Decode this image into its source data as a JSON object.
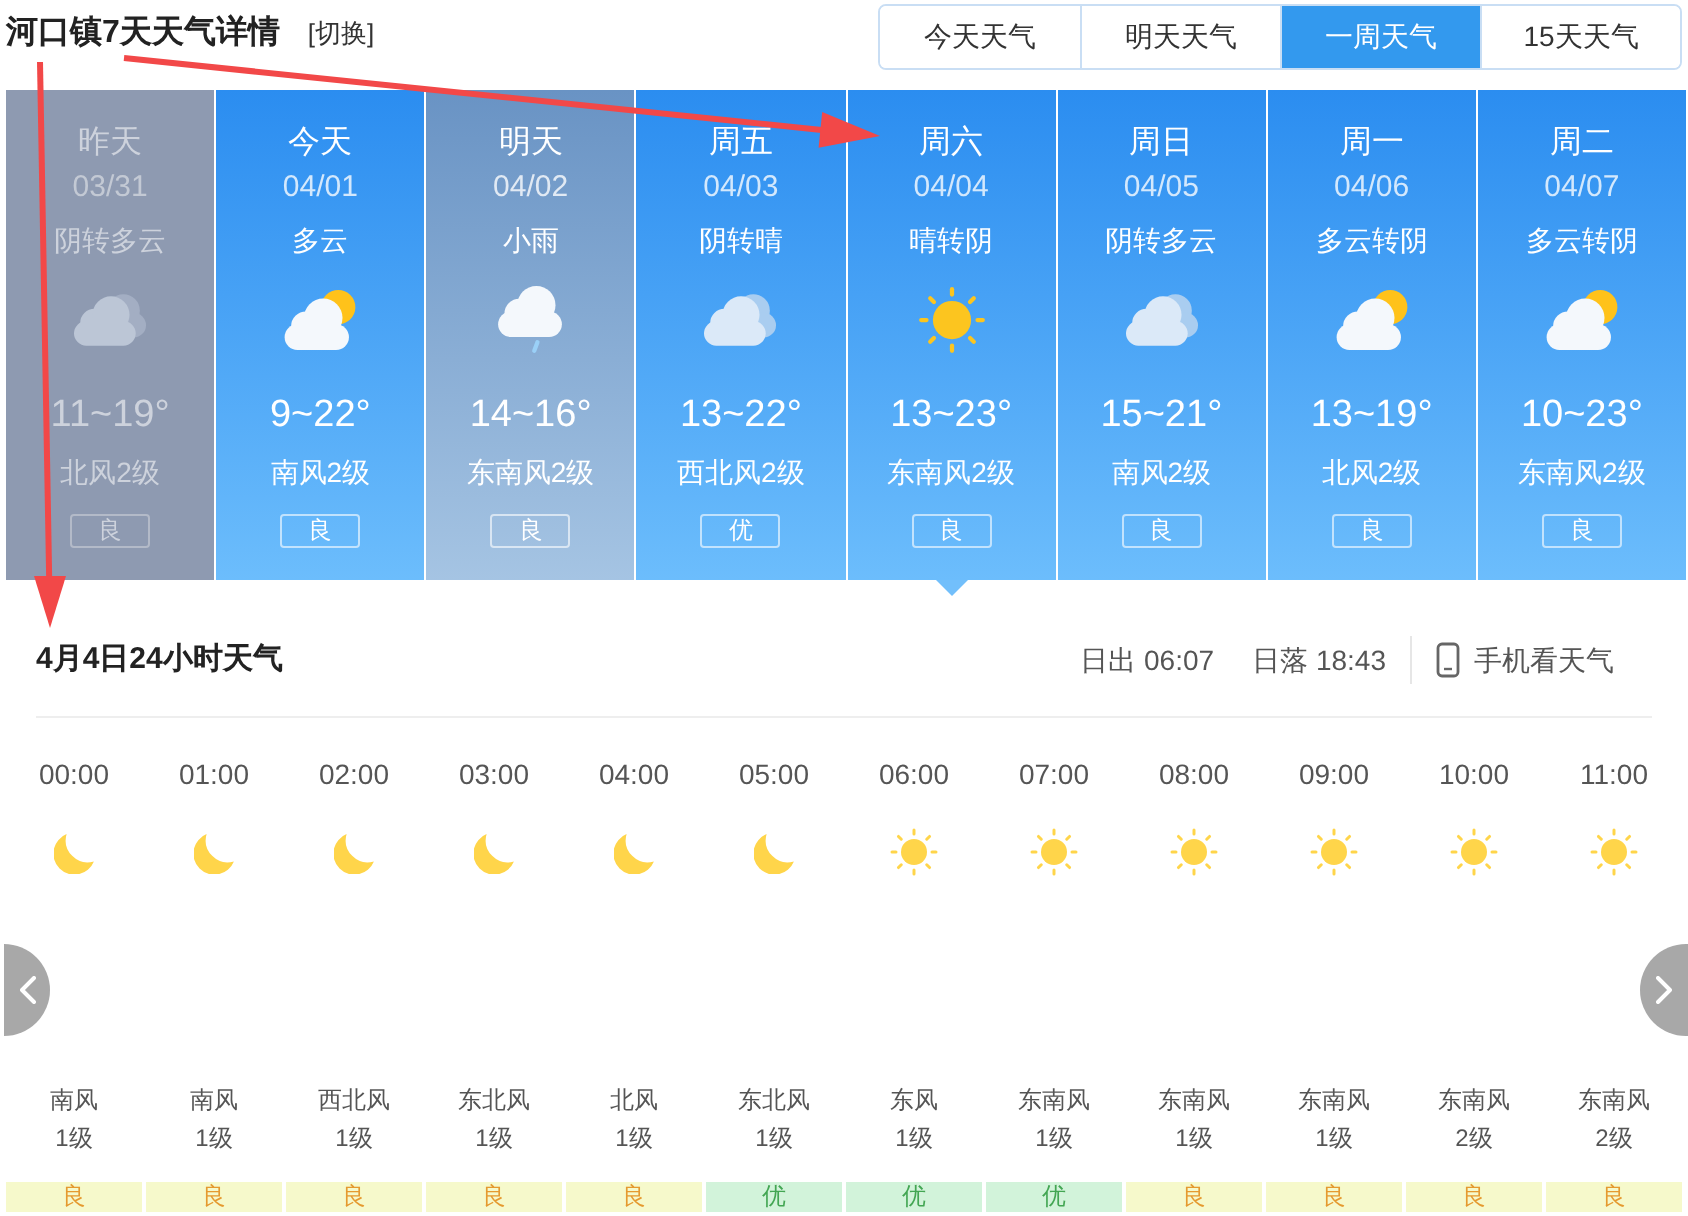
{
  "header": {
    "title": "河口镇7天天气详情",
    "switch_link": "[切换]"
  },
  "tabs": [
    {
      "label": "今天天气",
      "selected": false
    },
    {
      "label": "明天天气",
      "selected": false
    },
    {
      "label": "一周天气",
      "selected": true
    },
    {
      "label": "15天天气",
      "selected": false
    }
  ],
  "days": [
    {
      "day": "昨天",
      "date": "03/31",
      "weather": "阴转多云",
      "kind": "overcast",
      "temp": "11~19°",
      "wind": "北风2级",
      "aqi": "良",
      "past": true,
      "hovered": false,
      "selected": false
    },
    {
      "day": "今天",
      "date": "04/01",
      "weather": "多云",
      "kind": "partly_cloudy",
      "temp": "9~22°",
      "wind": "南风2级",
      "aqi": "良",
      "past": false,
      "hovered": false,
      "selected": false
    },
    {
      "day": "明天",
      "date": "04/02",
      "weather": "小雨",
      "kind": "light_rain",
      "temp": "14~16°",
      "wind": "东南风2级",
      "aqi": "良",
      "past": false,
      "hovered": true,
      "selected": false
    },
    {
      "day": "周五",
      "date": "04/03",
      "weather": "阴转晴",
      "kind": "overcast",
      "temp": "13~22°",
      "wind": "西北风2级",
      "aqi": "优",
      "past": false,
      "hovered": false,
      "selected": false
    },
    {
      "day": "周六",
      "date": "04/04",
      "weather": "晴转阴",
      "kind": "sunny",
      "temp": "13~23°",
      "wind": "东南风2级",
      "aqi": "良",
      "past": false,
      "hovered": false,
      "selected": true
    },
    {
      "day": "周日",
      "date": "04/05",
      "weather": "阴转多云",
      "kind": "overcast",
      "temp": "15~21°",
      "wind": "南风2级",
      "aqi": "良",
      "past": false,
      "hovered": false,
      "selected": false
    },
    {
      "day": "周一",
      "date": "04/06",
      "weather": "多云转阴",
      "kind": "partly_cloudy",
      "temp": "13~19°",
      "wind": "北风2级",
      "aqi": "良",
      "past": false,
      "hovered": false,
      "selected": false
    },
    {
      "day": "周二",
      "date": "04/07",
      "weather": "多云转阴",
      "kind": "partly_cloudy",
      "temp": "10~23°",
      "wind": "东南风2级",
      "aqi": "良",
      "past": false,
      "hovered": false,
      "selected": false
    }
  ],
  "hourly": {
    "title": "4月4日24小时天气",
    "sunrise": "日出 06:07",
    "sunset": "日落 18:43",
    "mobile_link": "手机看天气",
    "hours": [
      {
        "time": "00:00",
        "kind": "clear_night",
        "wind_direction": "南风",
        "wind_level": "1级",
        "aqi": {
          "kind": "good",
          "label": "良"
        }
      },
      {
        "time": "01:00",
        "kind": "clear_night",
        "wind_direction": "南风",
        "wind_level": "1级",
        "aqi": {
          "kind": "good",
          "label": "良"
        }
      },
      {
        "time": "02:00",
        "kind": "clear_night",
        "wind_direction": "西北风",
        "wind_level": "1级",
        "aqi": {
          "kind": "good",
          "label": "良"
        }
      },
      {
        "time": "03:00",
        "kind": "clear_night",
        "wind_direction": "东北风",
        "wind_level": "1级",
        "aqi": {
          "kind": "good",
          "label": "良"
        }
      },
      {
        "time": "04:00",
        "kind": "clear_night",
        "wind_direction": "北风",
        "wind_level": "1级",
        "aqi": {
          "kind": "good",
          "label": "良"
        }
      },
      {
        "time": "05:00",
        "kind": "clear_night",
        "wind_direction": "东北风",
        "wind_level": "1级",
        "aqi": {
          "kind": "excellent",
          "label": "优"
        }
      },
      {
        "time": "06:00",
        "kind": "clear_day",
        "wind_direction": "东风",
        "wind_level": "1级",
        "aqi": {
          "kind": "excellent",
          "label": "优"
        }
      },
      {
        "time": "07:00",
        "kind": "clear_day",
        "wind_direction": "东南风",
        "wind_level": "1级",
        "aqi": {
          "kind": "excellent",
          "label": "优"
        }
      },
      {
        "time": "08:00",
        "kind": "clear_day",
        "wind_direction": "东南风",
        "wind_level": "1级",
        "aqi": {
          "kind": "good",
          "label": "良"
        }
      },
      {
        "time": "09:00",
        "kind": "clear_day",
        "wind_direction": "东南风",
        "wind_level": "1级",
        "aqi": {
          "kind": "good",
          "label": "良"
        }
      },
      {
        "time": "10:00",
        "kind": "clear_day",
        "wind_direction": "东南风",
        "wind_level": "2级",
        "aqi": {
          "kind": "good",
          "label": "良"
        }
      },
      {
        "time": "11:00",
        "kind": "clear_day",
        "wind_direction": "东南风",
        "wind_level": "2级",
        "aqi": {
          "kind": "good",
          "label": "良"
        }
      }
    ]
  },
  "annotations": [
    {
      "kind": "arrow"
    },
    {
      "kind": "arrow"
    }
  ]
}
